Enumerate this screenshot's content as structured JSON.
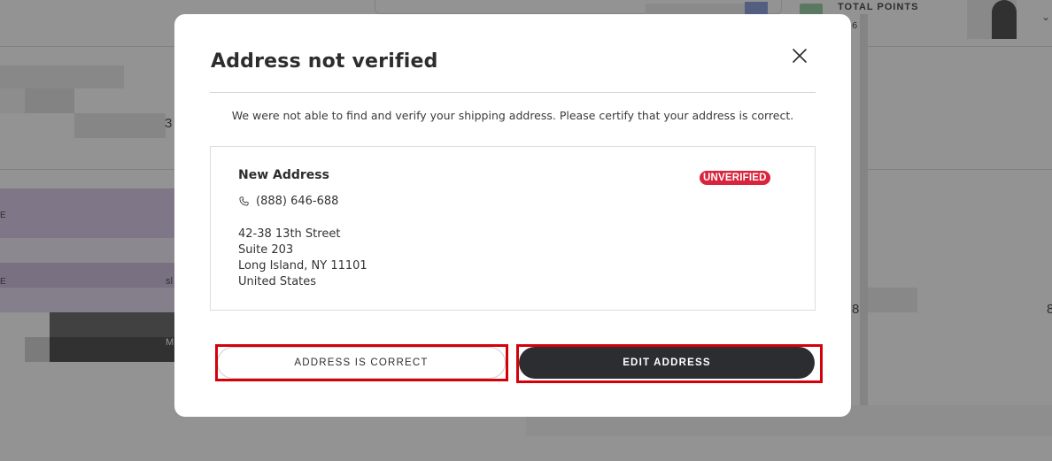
{
  "background": {
    "header_points_label": "TOTAL POINTS",
    "header_points_sub": "6",
    "chevron": "⌄",
    "left_digit": "3",
    "left_letter_1": "E",
    "left_letter_2": "E",
    "left_letter_3": "M",
    "left_letter_4": "sl",
    "right_digit_1": "8",
    "right_digit_2": "8"
  },
  "modal": {
    "title": "Address not verified",
    "message": "We were not able to find and verify your shipping address. Please certify that your address is correct.",
    "card": {
      "name": "New Address",
      "status_badge": "UNVERIFIED",
      "phone": "(888) 646-688",
      "address_lines": [
        "42-38 13th Street",
        "Suite 203",
        "Long Island, NY 11101",
        "United States"
      ]
    },
    "buttons": {
      "address_correct": "ADDRESS IS CORRECT",
      "edit_address": "EDIT ADDRESS"
    }
  },
  "colors": {
    "badge": "#d8243c",
    "primary_button": "#2c2d30",
    "highlight": "#d4000a"
  },
  "icons": {
    "close": "close-icon",
    "phone": "phone-icon"
  }
}
